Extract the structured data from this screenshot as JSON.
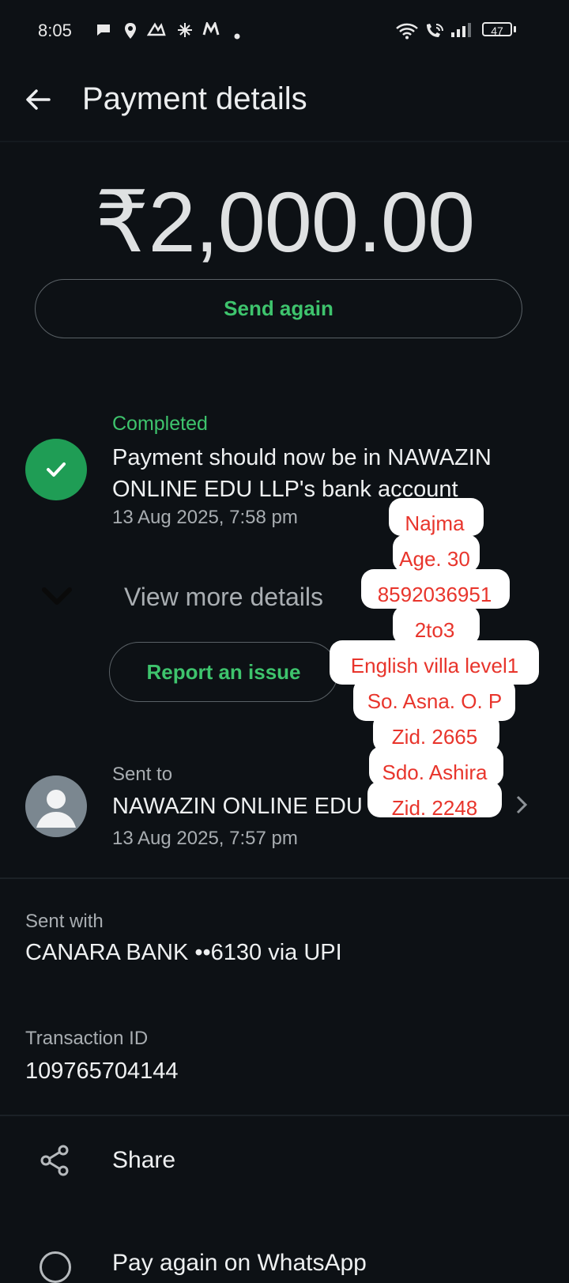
{
  "status_bar": {
    "time": "8:05",
    "notification_icons": [
      "chat-icon",
      "location-icon",
      "app-icon",
      "sparkle-icon",
      "m-icon",
      "dot-icon"
    ],
    "right_icons": [
      "wifi-icon",
      "wifi-call-icon",
      "signal-icon"
    ],
    "battery": "47"
  },
  "header": {
    "title": "Payment details"
  },
  "amount": "₹2,000.00",
  "send_again_label": "Send again",
  "status": {
    "label": "Completed",
    "description": "Payment should now be in NAWAZIN ONLINE EDU LLP's bank account",
    "timestamp": "13 Aug 2025, 7:58 pm"
  },
  "view_more_label": "View more details",
  "report_label": "Report an issue",
  "sent_to": {
    "label": "Sent to",
    "name": "NAWAZIN ONLINE EDU LLP",
    "timestamp": "13 Aug 2025, 7:57 pm"
  },
  "sent_with": {
    "label": "Sent with",
    "value": "CANARA BANK ••6130 via UPI"
  },
  "transaction": {
    "label": "Transaction ID",
    "value": "109765704144"
  },
  "share_label": "Share",
  "bottom_item_label": "Pay again on WhatsApp",
  "note_lines": [
    "Najma",
    "Age. 30",
    "8592036951",
    "2to3",
    "English villa level1",
    "So. Asna. O. P",
    "Zid. 2665",
    "Sdo. Ashira",
    "Zid. 2248"
  ],
  "colors": {
    "background": "#0d1115",
    "accent_green": "#3ec46d",
    "check_green": "#1f9d55",
    "note_red": "#e8352c"
  }
}
